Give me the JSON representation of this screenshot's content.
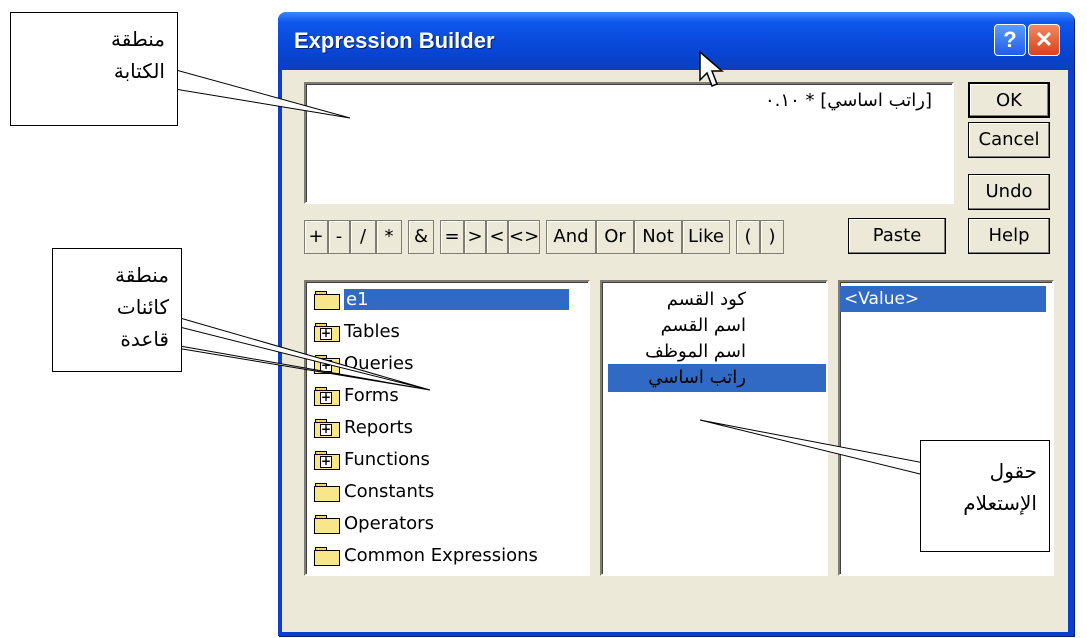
{
  "window": {
    "title": "Expression Builder",
    "help_icon": "help-icon",
    "close_icon": "close-icon"
  },
  "expression": {
    "text": "[راتب اساسي] * ٠.١٠"
  },
  "buttons": {
    "ok": "OK",
    "cancel": "Cancel",
    "undo": "Undo",
    "paste": "Paste",
    "help": "Help"
  },
  "operators": [
    "+",
    "-",
    "/",
    "*",
    "&",
    "=",
    ">",
    "<",
    "<>",
    "And",
    "Or",
    "Not",
    "Like",
    "(",
    ")"
  ],
  "objects_tree": [
    {
      "label": "e1",
      "icon": "open-folder-icon",
      "selected": true
    },
    {
      "label": "Tables",
      "icon": "plus-folder-icon"
    },
    {
      "label": "Queries",
      "icon": "plus-folder-icon"
    },
    {
      "label": "Forms",
      "icon": "plus-folder-icon"
    },
    {
      "label": "Reports",
      "icon": "plus-folder-icon"
    },
    {
      "label": "Functions",
      "icon": "plus-folder-icon"
    },
    {
      "label": "Constants",
      "icon": "folder-icon"
    },
    {
      "label": "Operators",
      "icon": "folder-icon"
    },
    {
      "label": "Common Expressions",
      "icon": "folder-icon"
    }
  ],
  "fields": [
    {
      "label": "كود القسم"
    },
    {
      "label": "اسم القسم"
    },
    {
      "label": "اسم الموظف"
    },
    {
      "label": "راتب اساسي",
      "selected": true
    }
  ],
  "values": [
    {
      "label": "<Value>",
      "selected": true
    }
  ],
  "callouts": {
    "writing_area": [
      "منطقة",
      "الكتابة"
    ],
    "objects_area": [
      "منطقة",
      "كائنات",
      "قاعدة"
    ],
    "query_fields": [
      "حقول",
      "الإستعلام"
    ]
  },
  "colors": {
    "titlebar": "#0847d8",
    "selection": "#316ac5",
    "dialog_face": "#ece9d8"
  }
}
